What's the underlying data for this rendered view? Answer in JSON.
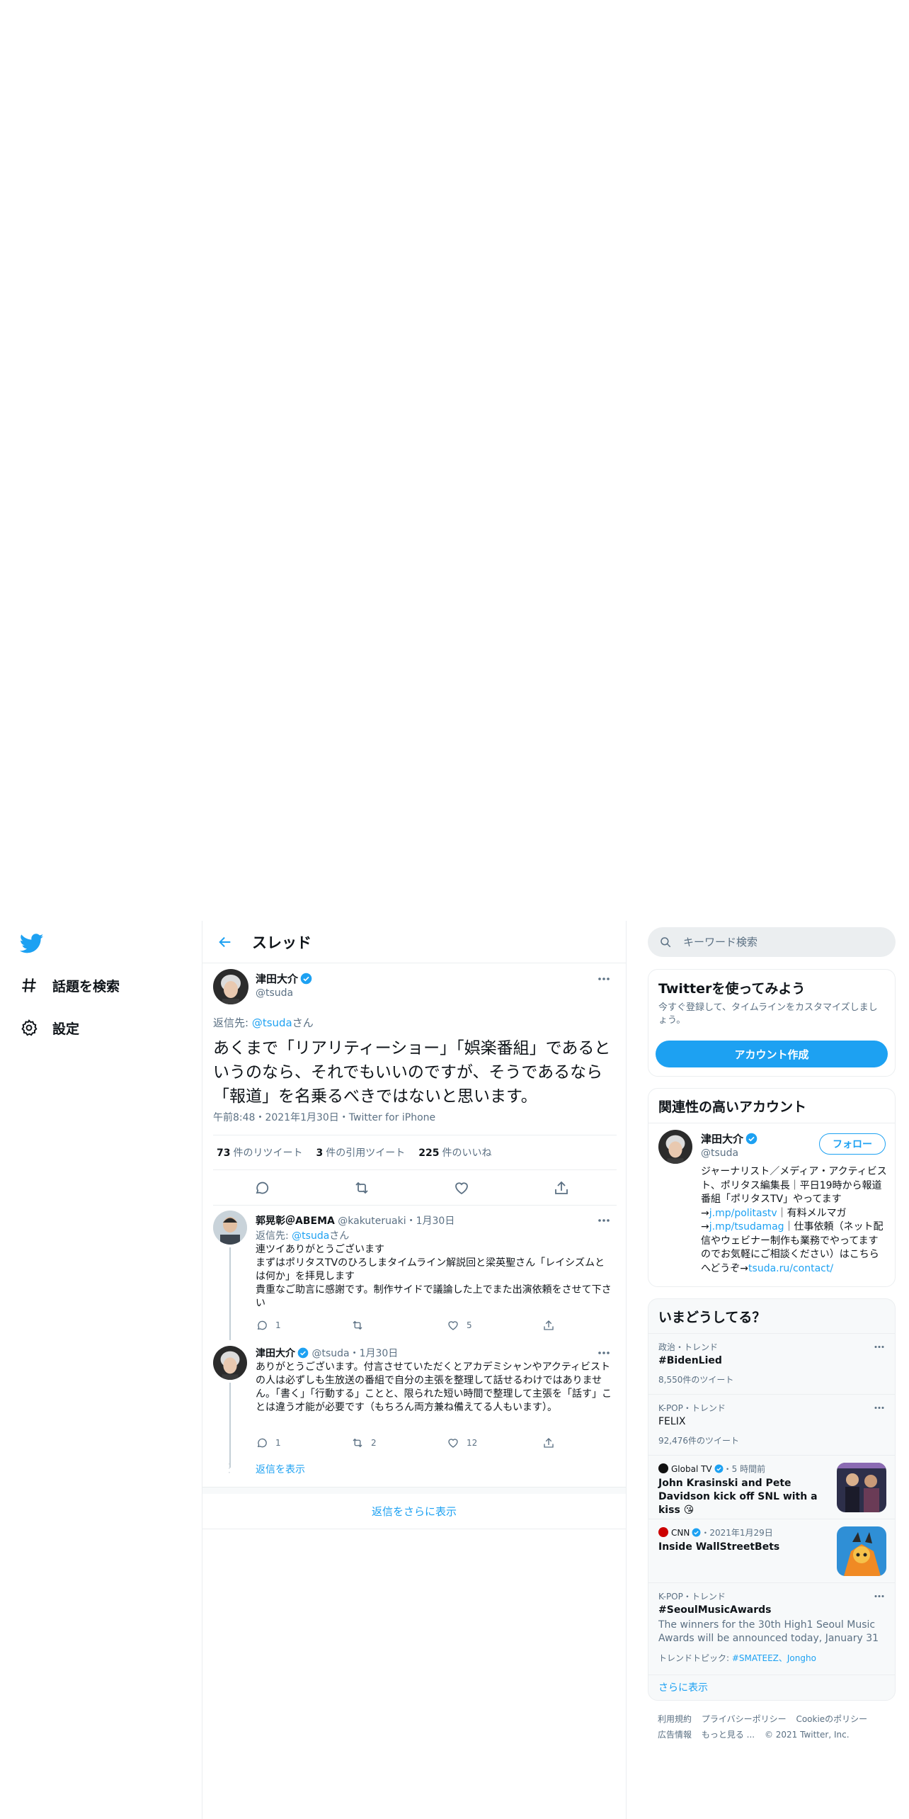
{
  "colors": {
    "accent": "#1da1f2",
    "text": "#0f1419",
    "secondary": "#5b7083",
    "border": "#ebeef0"
  },
  "nav": {
    "logo_icon": "twitter-bird-icon",
    "items": [
      {
        "label": "話題を検索",
        "icon": "hashtag-icon"
      },
      {
        "label": "設定",
        "icon": "gear-icon"
      }
    ]
  },
  "thread": {
    "title": "スレッド",
    "focus": {
      "name": "津田大介",
      "handle": "@tsuda",
      "reply_prefix": "返信先: ",
      "reply_handle": "@tsuda",
      "reply_suffix": "さん",
      "text": "あくまで「リアリティーショー」「娯楽番組」であるというのなら、それでもいいのですが、そうであるなら「報道」を名乗るべきではないと思います。",
      "meta": "午前8:48・2021年1月30日・Twitter for iPhone",
      "stats": [
        {
          "count": "73",
          "label": "件のリツイート"
        },
        {
          "count": "3",
          "label": "件の引用ツイート"
        },
        {
          "count": "225",
          "label": "件のいいね"
        }
      ]
    },
    "replies": [
      {
        "name": "郭晃彰＠ABEMA",
        "handle": "@kakuteruaki",
        "date": "・1月30日",
        "reply_prefix": "返信先: ",
        "reply_handle": "@tsuda",
        "reply_suffix": "さん",
        "lines": [
          "連ツイありがとうございます",
          "まずはポリタスTVのひろしまタイムライン解説回と梁英聖さん「レイシズムとは何か」を拝見します",
          "貴重なご助言に感謝です。制作サイドで議論した上でまた出演依頼をさせて下さい"
        ],
        "counts": {
          "reply": "1",
          "retweet": "",
          "like": "5"
        }
      },
      {
        "name": "津田大介",
        "handle": "@tsuda",
        "date": "・1月30日",
        "lines": [
          "ありがとうございます。付言させていただくとアカデミシャンやアクティビストの人は必ずしも生放送の番組で自分の主張を整理して話せるわけではありません。「書く」「行動する」ことと、限られた短い時間で整理して主張を「話す」ことは違う才能が必要です（もちろん両方兼ね備えてる人もいます）。"
        ],
        "counts": {
          "reply": "1",
          "retweet": "2",
          "like": "12"
        }
      }
    ],
    "show_replies": "返信を表示",
    "more_replies": "返信をさらに表示"
  },
  "search": {
    "placeholder": "キーワード検索"
  },
  "signup": {
    "title": "Twitterを使ってみよう",
    "subtitle": "今すぐ登録して、タイムラインをカスタマイズしましょう。",
    "button": "アカウント作成"
  },
  "related": {
    "title": "関連性の高いアカウント",
    "name": "津田大介",
    "handle": "@tsuda",
    "follow": "フォロー",
    "bio_1": "ジャーナリスト／メディア・アクティビスト、ポリタス編集長｜平日19時から報道番組「ポリタスTV」やってます→",
    "bio_link1": "j.mp/politastv",
    "bio_2": "｜有料メルマガ→",
    "bio_link2": "j.mp/tsudamag",
    "bio_3": "｜仕事依頼（ネット配信やウェビナー制作も業務でやってますのでお気軽にご相談ください）はこちらへどうぞ→",
    "bio_link3": "tsuda.ru/contact/"
  },
  "trends": {
    "title": "いまどうしてる？",
    "items": [
      {
        "meta": "政治・トレンド",
        "title": "#BidenLied",
        "count": "8,550件のツイート"
      },
      {
        "meta": "K-POP・トレンド",
        "title": "FELIX",
        "count": "92,476件のツイート"
      },
      {
        "source": "Global TV",
        "time": "・5 時間前",
        "title": "John Krasinski and Pete Davidson kick off SNL with a kiss 😘"
      },
      {
        "source": "CNN",
        "time": "・2021年1月29日",
        "title": "Inside WallStreetBets"
      },
      {
        "meta": "K-POP・トレンド",
        "title": "#SeoulMusicAwards",
        "desc": "The winners for the 30th High1 Seoul Music Awards will be announced today, January 31",
        "topics_label": "トレンドトピック: ",
        "topics": "#SMATEEZ、Jongho"
      }
    ],
    "show_more": "さらに表示"
  },
  "footer": {
    "links_row1": [
      "利用規約",
      "プライバシーポリシー",
      "Cookieのポリシー"
    ],
    "links_row2": [
      "広告情報",
      "もっと見る ..."
    ],
    "copyright": "© 2021 Twitter, Inc."
  }
}
